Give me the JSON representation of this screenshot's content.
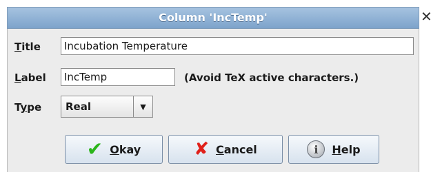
{
  "window": {
    "title": "Column 'IncTemp'",
    "close_glyph": "✕"
  },
  "form": {
    "title": {
      "label_u": "T",
      "label_rest": "itle",
      "value": "Incubation Temperature"
    },
    "label": {
      "label_u": "L",
      "label_rest": "abel",
      "value": "IncTemp",
      "hint": "(Avoid TeX active characters.)"
    },
    "type": {
      "label_pre": "T",
      "label_u": "y",
      "label_rest": "pe",
      "value": "Real"
    }
  },
  "buttons": {
    "okay": {
      "label_u": "O",
      "label_rest": "kay",
      "icon": "checkmark-icon"
    },
    "cancel": {
      "label_u": "C",
      "label_rest": "ancel",
      "icon": "x-icon"
    },
    "help": {
      "label_u": "H",
      "label_rest": "elp",
      "icon": "help-icon"
    }
  },
  "colors": {
    "check": "#2bb51b",
    "cross": "#e0201a",
    "titlebar": "#8fb0d4"
  }
}
